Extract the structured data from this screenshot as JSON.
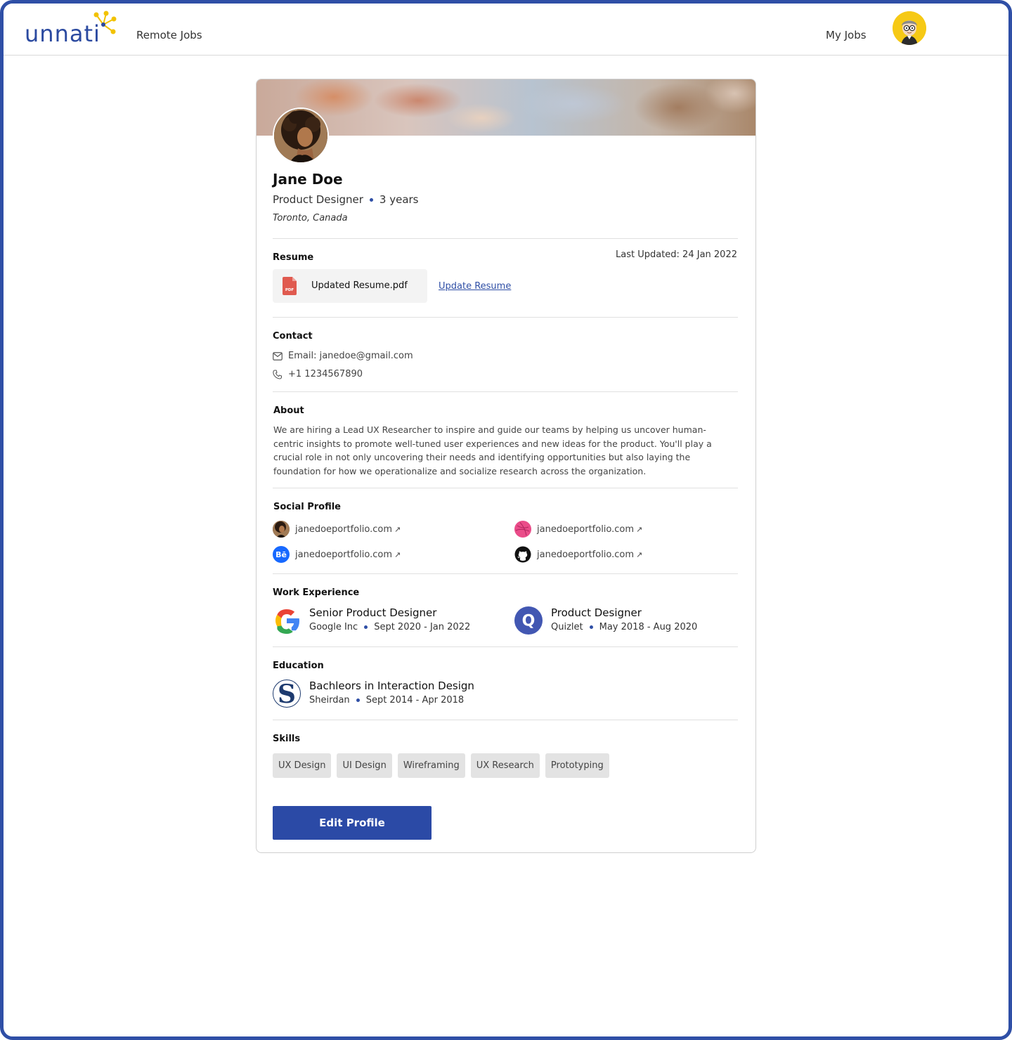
{
  "header": {
    "logo_text": "unnati",
    "nav_remote_jobs": "Remote Jobs",
    "nav_my_jobs": "My Jobs"
  },
  "profile": {
    "name": "Jane Doe",
    "role": "Product Designer",
    "experience": "3 years",
    "location": "Toronto, Canada"
  },
  "resume": {
    "title": "Resume",
    "last_updated": "Last Updated: 24 Jan 2022",
    "file_name": "Updated Resume.pdf",
    "pdf_badge": "PDF",
    "update_link": "Update Resume"
  },
  "contact": {
    "title": "Contact",
    "email": "Email: janedoe@gmail.com",
    "phone": "+1 1234567890"
  },
  "about": {
    "title": "About",
    "text": "We are hiring a Lead UX Researcher to inspire and guide our teams by helping us uncover human-centric insights to promote well-tuned user experiences and new ideas for the product. You'll play a crucial role in not only uncovering their needs and identifying opportunities but also laying the foundation for how we operationalize and socialize research across the organization."
  },
  "social": {
    "title": "Social Profile",
    "items": [
      {
        "icon": "portfolio-avatar-icon",
        "label": "janedoeportfolio.com"
      },
      {
        "icon": "dribbble-icon",
        "label": "janedoeportfolio.com"
      },
      {
        "icon": "behance-icon",
        "label": "janedoeportfolio.com",
        "badge": "Bē"
      },
      {
        "icon": "github-icon",
        "label": "janedoeportfolio.com"
      }
    ],
    "arrow": "↗"
  },
  "work": {
    "title": "Work Experience",
    "items": [
      {
        "title": "Senior Product Designer",
        "company": "Google Inc",
        "period": "Sept 2020 - Jan 2022",
        "logo": "google-logo-icon"
      },
      {
        "title": "Product Designer",
        "company": "Quizlet",
        "period": "May 2018 - Aug 2020",
        "logo": "quizlet-logo-icon",
        "logo_letter": "Q"
      }
    ]
  },
  "education": {
    "title": "Education",
    "items": [
      {
        "title": "Bachleors in Interaction Design",
        "school": "Sheirdan",
        "period": "Sept 2014 - Apr 2018",
        "logo": "sheridan-logo-icon",
        "logo_letter": "S"
      }
    ]
  },
  "skills": {
    "title": "Skills",
    "items": [
      "UX Design",
      "UI Design",
      "Wireframing",
      "UX Research",
      "Prototyping"
    ]
  },
  "actions": {
    "edit_profile": "Edit Profile"
  },
  "colors": {
    "brand": "#2b4aa6",
    "frame": "#2f4fa6",
    "logo_accent": "#f2c200"
  }
}
